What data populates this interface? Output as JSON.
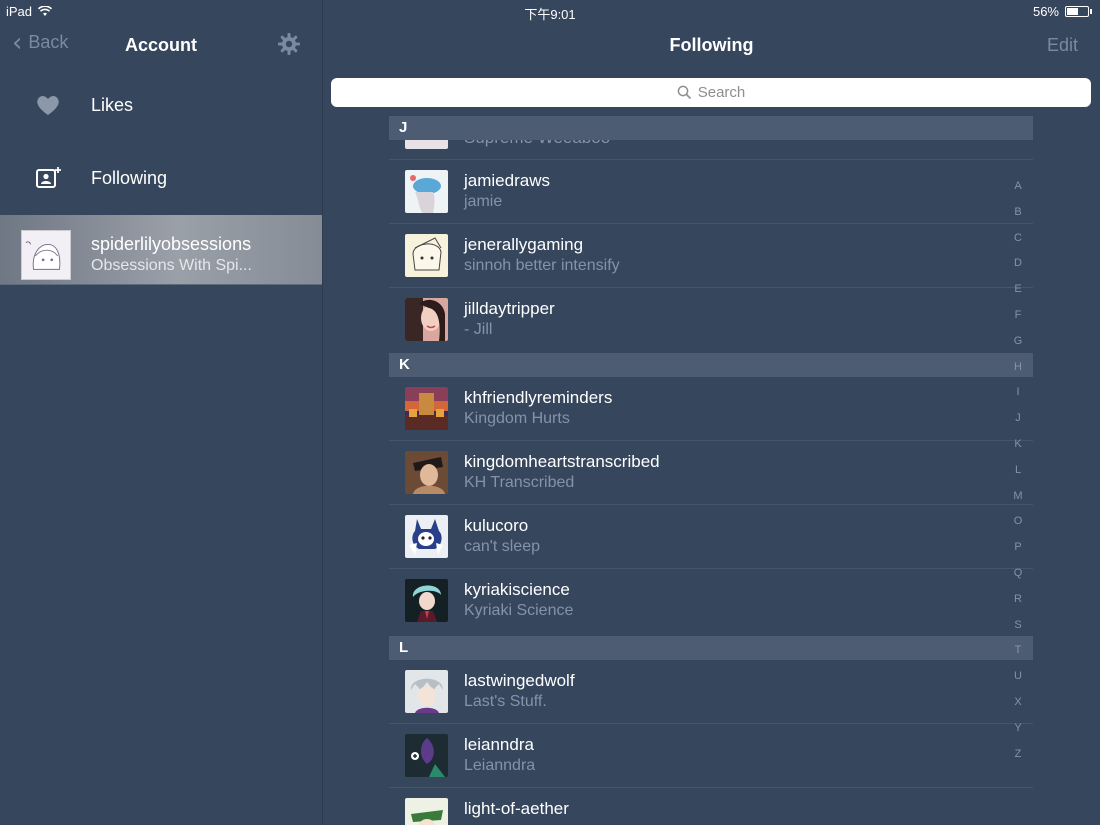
{
  "status_bar": {
    "device": "iPad",
    "time": "下午9:01",
    "battery": "56%",
    "battery_level": 0.56
  },
  "sidebar": {
    "back_label": "Back",
    "title": "Account",
    "items": [
      {
        "label": "Likes",
        "icon": "heart-icon"
      },
      {
        "label": "Following",
        "icon": "contact-card-icon"
      }
    ],
    "blog": {
      "name": "spiderlilyobsessions",
      "subtitle": "Obsessions With Spi..."
    }
  },
  "main": {
    "title": "Following",
    "edit_label": "Edit",
    "search_placeholder": "Search",
    "partial_top_row": "Supreme Weeaboo",
    "sections": [
      {
        "letter": "J",
        "rows": [
          {
            "name": "jamiedraws",
            "subtitle": "jamie",
            "color": "#eaf2f8"
          },
          {
            "name": "jenerallygaming",
            "subtitle": "sinnoh better intensify",
            "color": "#f6f0d8"
          },
          {
            "name": "jilldaytripper",
            "subtitle": "- Jill",
            "color": "#a7544f"
          }
        ]
      },
      {
        "letter": "K",
        "rows": [
          {
            "name": "khfriendlyreminders",
            "subtitle": "Kingdom Hurts",
            "color": "#9b4a2a"
          },
          {
            "name": "kingdomheartstranscribed",
            "subtitle": "KH Transcribed",
            "color": "#7a5a43"
          },
          {
            "name": "kulucoro",
            "subtitle": "can't sleep",
            "color": "#e8eef5"
          },
          {
            "name": "kyriakiscience",
            "subtitle": "Kyriaki Science",
            "color": "#1e2a2e"
          }
        ]
      },
      {
        "letter": "L",
        "rows": [
          {
            "name": "lastwingedwolf",
            "subtitle": "Last's Stuff.",
            "color": "#cfd4d8"
          },
          {
            "name": "leianndra",
            "subtitle": "Leianndra",
            "color": "#1d2b33"
          },
          {
            "name": "light-of-aether",
            "subtitle": "",
            "color": "#e8eddc"
          }
        ]
      }
    ],
    "index_letters": [
      "A",
      "B",
      "C",
      "D",
      "E",
      "F",
      "G",
      "H",
      "I",
      "J",
      "K",
      "L",
      "M",
      "O",
      "P",
      "Q",
      "R",
      "S",
      "T",
      "U",
      "X",
      "Y",
      "Z"
    ]
  }
}
